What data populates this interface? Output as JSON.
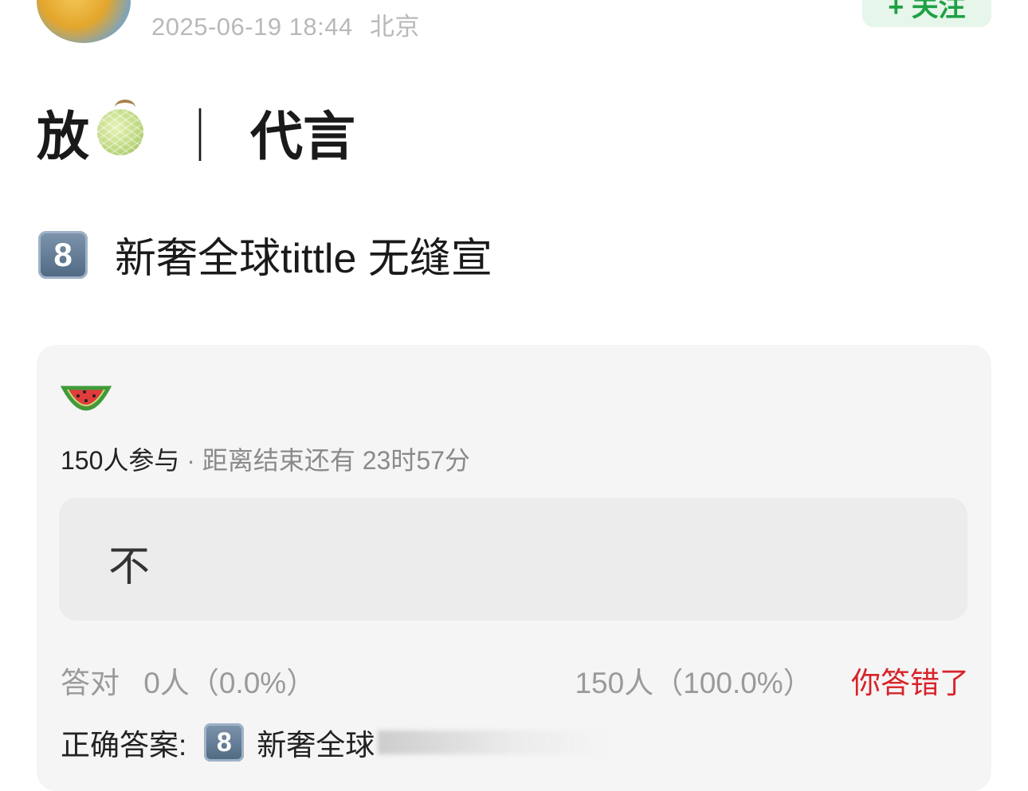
{
  "header": {
    "timestamp": "2025-06-19 18:44",
    "location": "北京",
    "follow_label": "+ 关注"
  },
  "post": {
    "title_start": "放",
    "title_sep": "｜",
    "title_end": "代言",
    "title_icon": "melon-emoji",
    "subtitle_key": "8",
    "subtitle_text": "新奢全球tittle 无缝宣"
  },
  "poll": {
    "icon": "watermelon-emoji",
    "participants": "150人参与",
    "remaining": "· 距离结束还有 23时57分",
    "option_label": "不",
    "correct_label": "答对",
    "correct_count": "0人（0.0%）",
    "wrong_count": "150人（100.0%）",
    "wrong_label": "你答错了",
    "answer_prefix": "正确答案:",
    "answer_key": "8",
    "answer_text": "新奢全球"
  },
  "colors": {
    "follow_bg": "#e6f6ea",
    "follow_text": "#1fa045",
    "wrong_text": "#d8232a",
    "card_bg": "#f5f5f5"
  }
}
